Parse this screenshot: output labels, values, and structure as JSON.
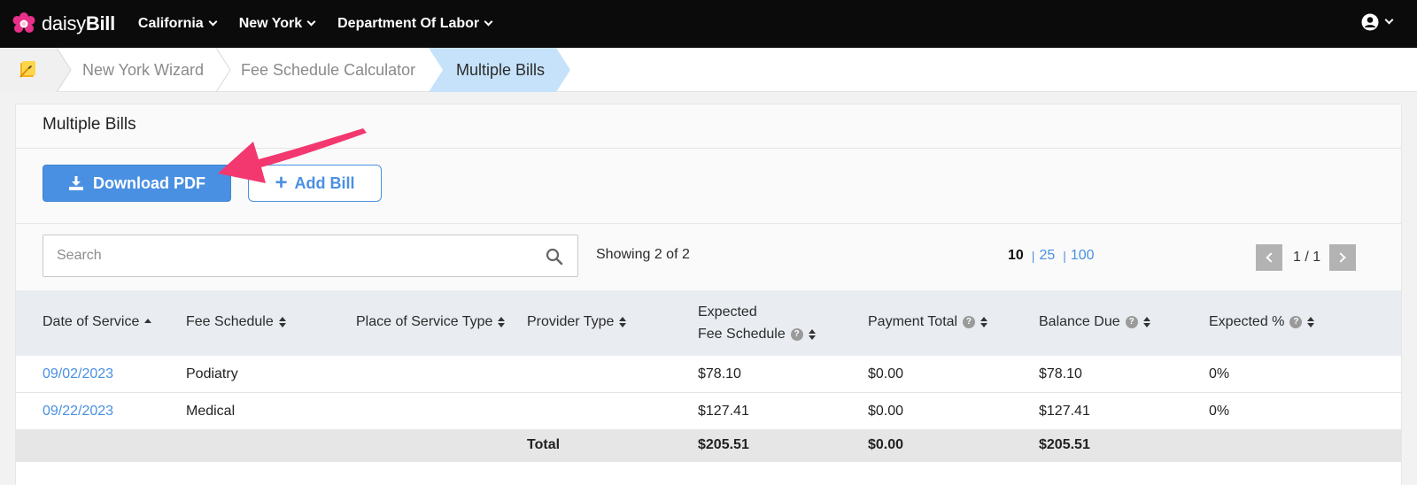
{
  "nav": {
    "logo_light": "daisy",
    "logo_bold": "Bill",
    "items": [
      "California",
      "New York",
      "Department Of Labor"
    ]
  },
  "breadcrumb": [
    "New York Wizard",
    "Fee Schedule Calculator",
    "Multiple Bills"
  ],
  "panel": {
    "title": "Multiple Bills",
    "download_label": "Download PDF",
    "add_label": "Add Bill"
  },
  "search": {
    "placeholder": "Search"
  },
  "showing": "Showing 2 of 2",
  "page_sizes": {
    "current": "10",
    "options": [
      "25",
      "100"
    ]
  },
  "pager": {
    "label": "1 / 1"
  },
  "table": {
    "headers": {
      "date": "Date of Service",
      "fee": "Fee Schedule",
      "place": "Place of Service Type",
      "provider": "Provider Type",
      "expected_line1": "Expected",
      "expected_line2": "Fee Schedule",
      "payment": "Payment Total",
      "balance": "Balance Due",
      "expected_pct": "Expected %"
    },
    "rows": [
      {
        "date": "09/02/2023",
        "fee": "Podiatry",
        "place": "",
        "provider": "",
        "expected": "$78.10",
        "payment": "$0.00",
        "balance": "$78.10",
        "pct": "0%"
      },
      {
        "date": "09/22/2023",
        "fee": "Medical",
        "place": "",
        "provider": "",
        "expected": "$127.41",
        "payment": "$0.00",
        "balance": "$127.41",
        "pct": "0%"
      }
    ],
    "total": {
      "label": "Total",
      "expected": "$205.51",
      "payment": "$0.00",
      "balance": "$205.51"
    }
  },
  "colors": {
    "accent": "#4a90e2",
    "arrow": "#f2386e",
    "topbar": "#0b0b0b",
    "active_crumb": "#c6e2fb"
  }
}
